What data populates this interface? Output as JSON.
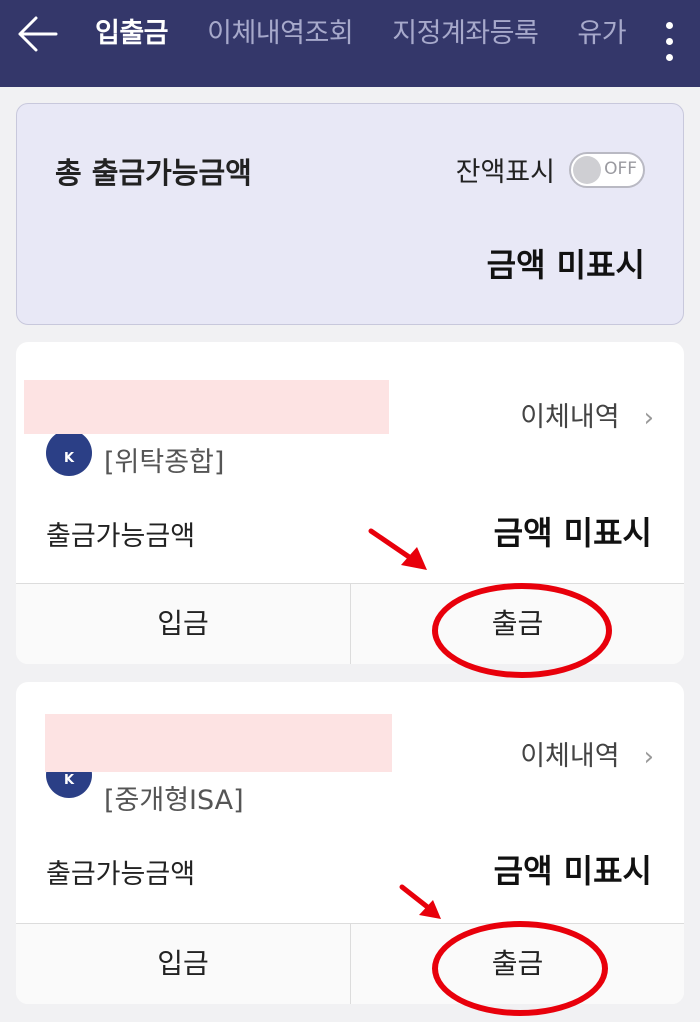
{
  "header": {
    "back_icon": "back-arrow-icon",
    "tabs": [
      {
        "label": "입출금",
        "active": true
      },
      {
        "label": "이체내역조회",
        "active": false
      },
      {
        "label": "지정계좌등록",
        "active": false
      },
      {
        "label": "유가",
        "active": false
      }
    ],
    "more_icon": "more-vertical-icon"
  },
  "summary": {
    "title": "총 출금가능금액",
    "toggle_label": "잔액표시",
    "toggle_state": "OFF",
    "amount": "금액 미표시"
  },
  "accounts": [
    {
      "logo_letter": "K",
      "type": "[위탁종합]",
      "history_label": "이체내역",
      "available_label": "출금가능금액",
      "available_amount": "금액 미표시",
      "deposit_label": "입금",
      "withdraw_label": "출금"
    },
    {
      "logo_letter": "K",
      "type": "[중개형ISA]",
      "history_label": "이체내역",
      "available_label": "출금가능금액",
      "available_amount": "금액 미표시",
      "deposit_label": "입금",
      "withdraw_label": "출금"
    }
  ],
  "colors": {
    "header_bg": "#34376a",
    "summary_bg": "#e8e8f6",
    "annotation_red": "#e8000b",
    "redaction": "#fde3e3"
  }
}
